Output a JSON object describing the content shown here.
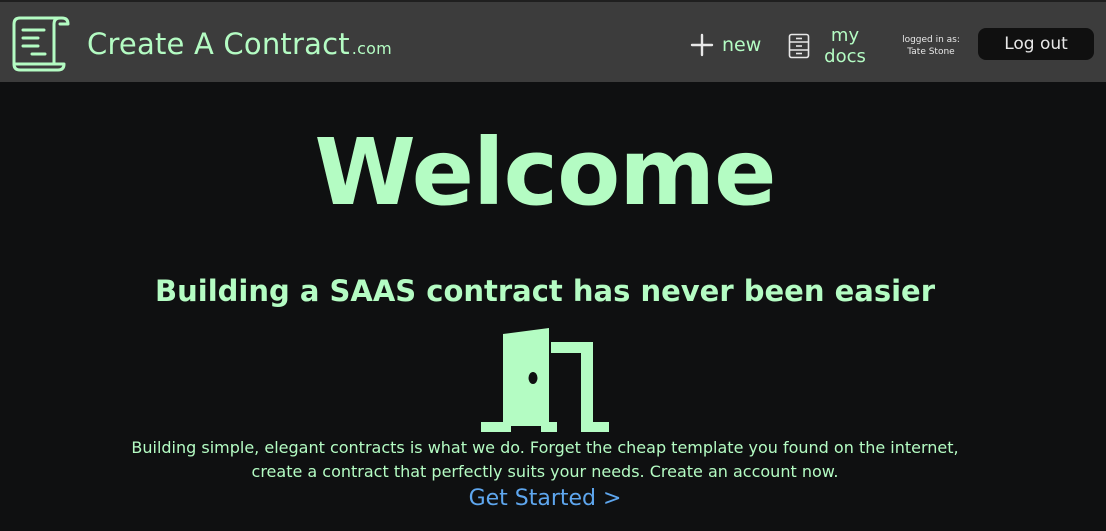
{
  "header": {
    "brand": "Create A Contract",
    "brand_suffix": ".com",
    "nav_new_label": "new",
    "nav_docs_line1": "my",
    "nav_docs_line2": "docs",
    "logged_in_label": "logged in as:",
    "user_name": "Tate Stone",
    "logout_label": "Log out"
  },
  "hero": {
    "title": "Welcome",
    "tagline": "Building a SAAS contract has never been easier",
    "description_line1": "Building simple, elegant contracts is what we do. Forget the cheap template you found on the internet,",
    "description_line2": "create a contract that perfectly suits your needs. Create an account now.",
    "cta_label": "Get Started >"
  },
  "icons": {
    "logo": "scroll-document-icon",
    "new": "plus-icon",
    "docs": "file-cabinet-icon",
    "hero": "open-door-icon"
  },
  "colors": {
    "accent": "#b4fcc3",
    "link": "#5ea6ee",
    "header_bg": "#3c3c3c",
    "page_bg": "#0f1011"
  }
}
